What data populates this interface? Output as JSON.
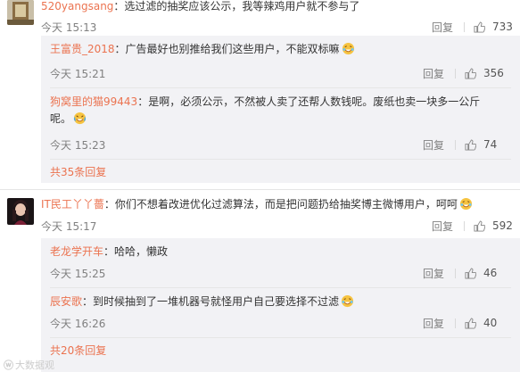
{
  "threads": [
    {
      "user": "520yangsang",
      "text": "：选过滤的抽奖应该公示，我等辣鸡用户就不参与了",
      "time": "今天 15:13",
      "reply_label": "回复",
      "likes": "733",
      "replies": [
        {
          "user": "王富贵_2018",
          "text": "：广告最好也别推给我们这些用户，不能双标嘛",
          "emoji": true,
          "time": "今天 15:21",
          "reply_label": "回复",
          "likes": "356"
        },
        {
          "user": "狗窝里的猫99443",
          "text": "：是啊，必须公示，不然被人卖了还帮人数钱呢。废纸也卖一块多一公斤",
          "text2": "呢。",
          "emoji": true,
          "time": "今天 15:23",
          "reply_label": "回复",
          "likes": "74"
        }
      ],
      "more": "共35条回复"
    },
    {
      "user": "IT民工丫丫薔",
      "text": "：你们不想着改进优化过滤算法，而是把问题扔给抽奖博主微博用户，呵呵",
      "time": "今天 15:17",
      "reply_label": "回复",
      "likes": "592",
      "replies": [
        {
          "user": "老龙学开车",
          "text": "：哈哈，懒政",
          "emoji": false,
          "time": "今天 15:25",
          "reply_label": "回复",
          "likes": "46"
        },
        {
          "user": "辰安歌",
          "text": "：到时候抽到了一堆机器号就怪用户自己要选择不过滤",
          "emoji": true,
          "time": "今天 16:26",
          "reply_label": "回复",
          "likes": "40"
        }
      ],
      "more": "共20条回复"
    }
  ],
  "watermark": "大数据观",
  "colors": {
    "username": "#eb7350",
    "reply_bg": "#f2f2f5",
    "meta": "#808080"
  }
}
